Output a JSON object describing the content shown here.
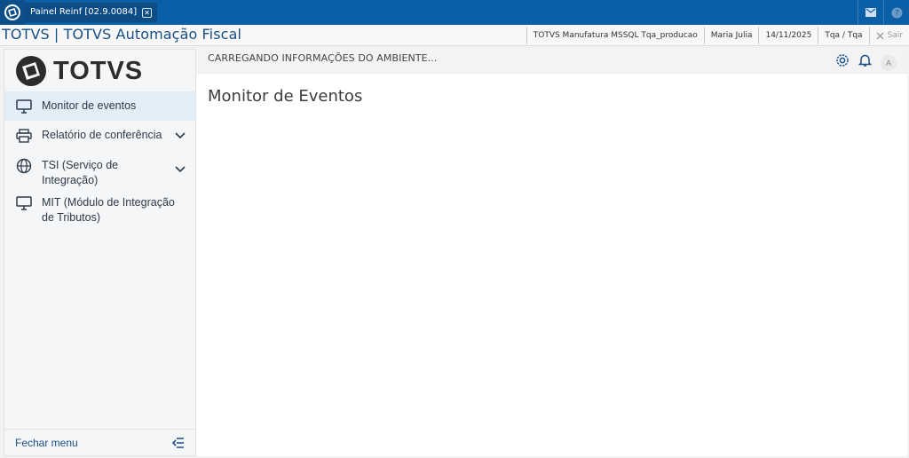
{
  "window": {
    "tab_title": "Painel Reinf [02.9.0084]",
    "tab_close_glyph": "✕"
  },
  "appbar": {
    "title": "TOTVS | TOTVS Automação Fiscal",
    "environment": "TOTVS Manufatura MSSQL Tqa_producao",
    "user": "Maria Julia",
    "date": "14/11/2025",
    "branch": "Tqa / Tqa",
    "exit_label": "Sair"
  },
  "sidebar": {
    "brand": "TOTVS",
    "items": [
      {
        "label": "Monitor de eventos",
        "icon": "monitor-icon",
        "active": true
      },
      {
        "label": "Relatório de conferência",
        "icon": "printer-icon",
        "expandable": true
      },
      {
        "label": "TSI (Serviço de Integração)",
        "icon": "globe-icon",
        "expandable": true
      },
      {
        "label": "MIT (Módulo de Integração de Tributos)",
        "icon": "monitor-icon"
      }
    ],
    "footer_label": "Fechar menu"
  },
  "main": {
    "status_text": "CARREGANDO INFORMAÇÕES DO AMBIENTE...",
    "page_title": "Monitor de Eventos",
    "avatar_initial": "A"
  },
  "colors": {
    "titlebar": "#0a5fa6",
    "accent": "#1a4f86",
    "active_item": "#e1eef8"
  }
}
